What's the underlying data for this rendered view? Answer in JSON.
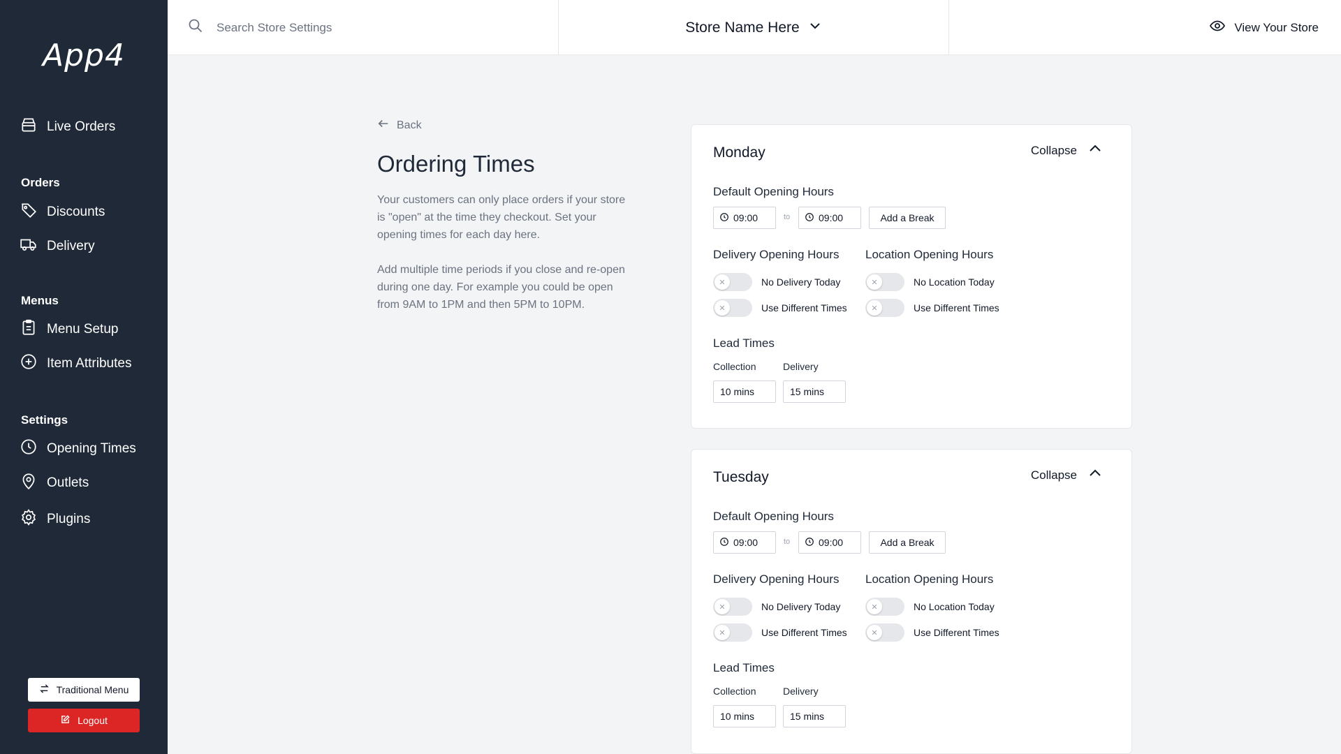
{
  "sidebar": {
    "logo": "App4",
    "items": {
      "live_orders": "Live Orders",
      "discounts": "Discounts",
      "delivery": "Delivery",
      "menu_setup": "Menu Setup",
      "item_attributes": "Item Attributes",
      "opening_times": "Opening Times",
      "outlets": "Outlets",
      "plugins": "Plugins"
    },
    "sections": {
      "orders": "Orders",
      "menus": "Menus",
      "settings": "Settings"
    },
    "traditional_menu": "Traditional Menu",
    "logout": "Logout"
  },
  "topbar": {
    "search_placeholder": "Search Store Settings",
    "store_name": "Store Name Here",
    "view_store": "View Your Store"
  },
  "page": {
    "back": "Back",
    "title": "Ordering Times",
    "desc1": "Your customers can only place orders if your store is \"open\" at the time they checkout. Set your opening times for each day here.",
    "desc2": "Add multiple time periods if you close and re-open during one day. For example you could be open from 9AM to 1PM and then 5PM to 10PM."
  },
  "days": [
    {
      "name": "Monday",
      "collapse": "Collapse",
      "default_label": "Default Opening Hours",
      "from": "09:00",
      "to_label": "to",
      "to": "09:00",
      "add_break": "Add a Break",
      "delivery_label": "Delivery Opening Hours",
      "location_label": "Location Opening Hours",
      "no_delivery": "No Delivery Today",
      "use_diff_delivery": "Use Different Times",
      "no_location": "No Location Today",
      "use_diff_location": "Use Different Times",
      "lead_label": "Lead Times",
      "collection_label": "Collection",
      "delivery_lead_label": "Delivery",
      "collection_value": "10 mins",
      "delivery_value": "15 mins"
    },
    {
      "name": "Tuesday",
      "collapse": "Collapse",
      "default_label": "Default Opening Hours",
      "from": "09:00",
      "to_label": "to",
      "to": "09:00",
      "add_break": "Add a Break",
      "delivery_label": "Delivery Opening Hours",
      "location_label": "Location Opening Hours",
      "no_delivery": "No Delivery Today",
      "use_diff_delivery": "Use Different Times",
      "no_location": "No Location Today",
      "use_diff_location": "Use Different Times",
      "lead_label": "Lead Times",
      "collection_label": "Collection",
      "delivery_lead_label": "Delivery",
      "collection_value": "10 mins",
      "delivery_value": "15 mins"
    }
  ],
  "colors": {
    "sidebar_bg": "#1f2937",
    "logout_red": "#dc2626",
    "page_bg": "#f3f4f6"
  },
  "icons": {
    "store": "store-icon",
    "tag": "tag-icon",
    "truck": "truck-icon",
    "clipboard": "clipboard-icon",
    "plus_circle": "plus-circle-icon",
    "clock": "clock-icon",
    "map_pin": "map-pin-icon",
    "gear": "gear-icon",
    "swap": "swap-icon",
    "edit": "edit-icon",
    "search": "search-icon",
    "chevron_down": "chevron-down-icon",
    "eye": "eye-icon",
    "arrow_left": "arrow-left-icon",
    "chevron_up": "chevron-up-icon",
    "close": "close-icon"
  },
  "toggles": {
    "no_delivery_today": false,
    "use_different_delivery_times": false,
    "no_location_today": false,
    "use_different_location_times": false
  }
}
